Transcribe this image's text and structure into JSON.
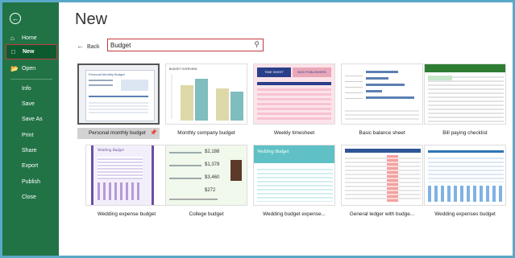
{
  "sidebar": {
    "back_icon": "back-arrow-circle-icon",
    "items": [
      {
        "label": "Home",
        "icon": "home-icon"
      },
      {
        "label": "New",
        "icon": "new-document-icon",
        "active": true
      },
      {
        "label": "Open",
        "icon": "folder-open-icon"
      }
    ],
    "commands": [
      "Info",
      "Save",
      "Save As",
      "Print",
      "Share",
      "Export",
      "Publish",
      "Close"
    ]
  },
  "header": {
    "title": "New",
    "back_label": "Back"
  },
  "search": {
    "value": "Budget",
    "icon": "search-icon"
  },
  "templates": [
    {
      "label": "Personal monthly budget",
      "selected": true,
      "pin_icon": "pin-icon",
      "thumb_heading": "Personal Monthly Budget"
    },
    {
      "label": "Monthly company budget",
      "thumb_heading": "BUDGET OVERVIEW"
    },
    {
      "label": "Weekly timesheet",
      "thumb_heading": "TIME SHEET",
      "thumb_subheading": "NOD PUBLISHERS"
    },
    {
      "label": "Basic balance sheet"
    },
    {
      "label": "Bill paying checklist"
    },
    {
      "label": "Wedding expense budget",
      "thumb_heading": "Wedding Budget"
    },
    {
      "label": "College budget",
      "thumb_values": [
        "$2,188",
        "$1,378",
        "$3,460",
        "$272"
      ]
    },
    {
      "label": "Wedding budget expense...",
      "thumb_heading": "Wedding Budget"
    },
    {
      "label": "General ledger with budge..."
    },
    {
      "label": "Wedding expenses budget"
    }
  ],
  "colors": {
    "sidebar_bg": "#217346",
    "sidebar_active_bg": "#0e5a2f",
    "highlight_border": "#c4393d",
    "frame_border": "#5aa8c8"
  }
}
